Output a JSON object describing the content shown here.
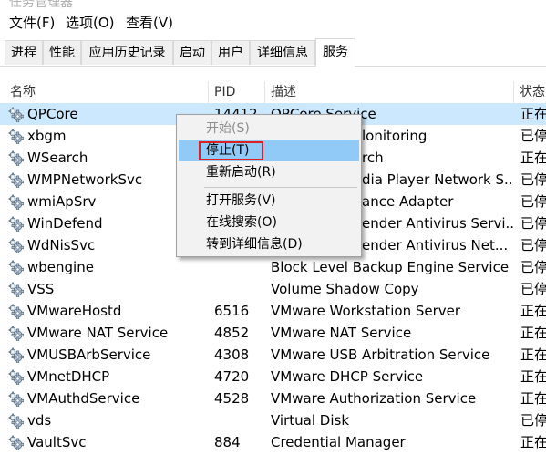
{
  "window": {
    "title": "任务管理器"
  },
  "menubar": {
    "items": [
      "文件(F)",
      "选项(O)",
      "查看(V)"
    ]
  },
  "tabs": [
    {
      "label": "进程",
      "active": false
    },
    {
      "label": "性能",
      "active": false
    },
    {
      "label": "应用历史记录",
      "active": false
    },
    {
      "label": "启动",
      "active": false
    },
    {
      "label": "用户",
      "active": false
    },
    {
      "label": "详细信息",
      "active": false
    },
    {
      "label": "服务",
      "active": true
    }
  ],
  "columns": {
    "name": "名称",
    "pid": "PID",
    "desc": "描述",
    "status": "状态"
  },
  "rows": [
    {
      "name": "QPCore",
      "pid": "14412",
      "desc": "QPCore Service",
      "status": "正在",
      "selected": true
    },
    {
      "name": "xbgm",
      "pid": "",
      "desc": "",
      "status": "已停"
    },
    {
      "name": "WSearch",
      "pid": "",
      "desc": "",
      "status": "正在"
    },
    {
      "name": "WMPNetworkSvc",
      "pid": "",
      "desc": "",
      "status": "已停"
    },
    {
      "name": "wmiApSrv",
      "pid": "",
      "desc": "",
      "status": "已停"
    },
    {
      "name": "WinDefend",
      "pid": "",
      "desc": "",
      "status": "已停"
    },
    {
      "name": "WdNisSvc",
      "pid": "",
      "desc": "",
      "status": "已停"
    },
    {
      "name": "wbengine",
      "pid": "",
      "desc": "Block Level Backup Engine Service",
      "status": "已停"
    },
    {
      "name": "VSS",
      "pid": "",
      "desc": "Volume Shadow Copy",
      "status": "已停"
    },
    {
      "name": "VMwareHostd",
      "pid": "6516",
      "desc": "VMware Workstation Server",
      "status": "正在"
    },
    {
      "name": "VMware NAT Service",
      "pid": "4852",
      "desc": "VMware NAT Service",
      "status": "正在"
    },
    {
      "name": "VMUSBArbService",
      "pid": "4308",
      "desc": "VMware USB Arbitration Service",
      "status": "正在"
    },
    {
      "name": "VMnetDHCP",
      "pid": "4720",
      "desc": "VMware DHCP Service",
      "status": "正在"
    },
    {
      "name": "VMAuthdService",
      "pid": "4528",
      "desc": "VMware Authorization Service",
      "status": "正在"
    },
    {
      "name": "vds",
      "pid": "",
      "desc": "Virtual Disk",
      "status": "已停"
    },
    {
      "name": "VaultSvc",
      "pid": "884",
      "desc": "Credential Manager",
      "status": "正在"
    }
  ],
  "context_menu": {
    "start": "开始(S)",
    "stop": "停止(T)",
    "restart": "重新启动(R)",
    "open_services": "打开服务(V)",
    "search_online": "在线搜索(O)",
    "go_details": "转到详细信息(D)"
  },
  "overlapped_text": {
    "qpcore_pid_tail": "14412",
    "xbgm_desc_tail": "lonitoring",
    "wsearch_desc_tail": "rch",
    "wmp_desc_tail": "dia Player Network S...",
    "wmiap_desc_tail": "ance Adapter",
    "windefend_desc_tail": "ender Antivirus Servi...",
    "wdnis_desc_tail": "ender Antivirus Net..."
  },
  "colors": {
    "selected_row": "#cce8ff",
    "menu_hover": "#91c9f7",
    "highlight_box": "#e02020"
  }
}
